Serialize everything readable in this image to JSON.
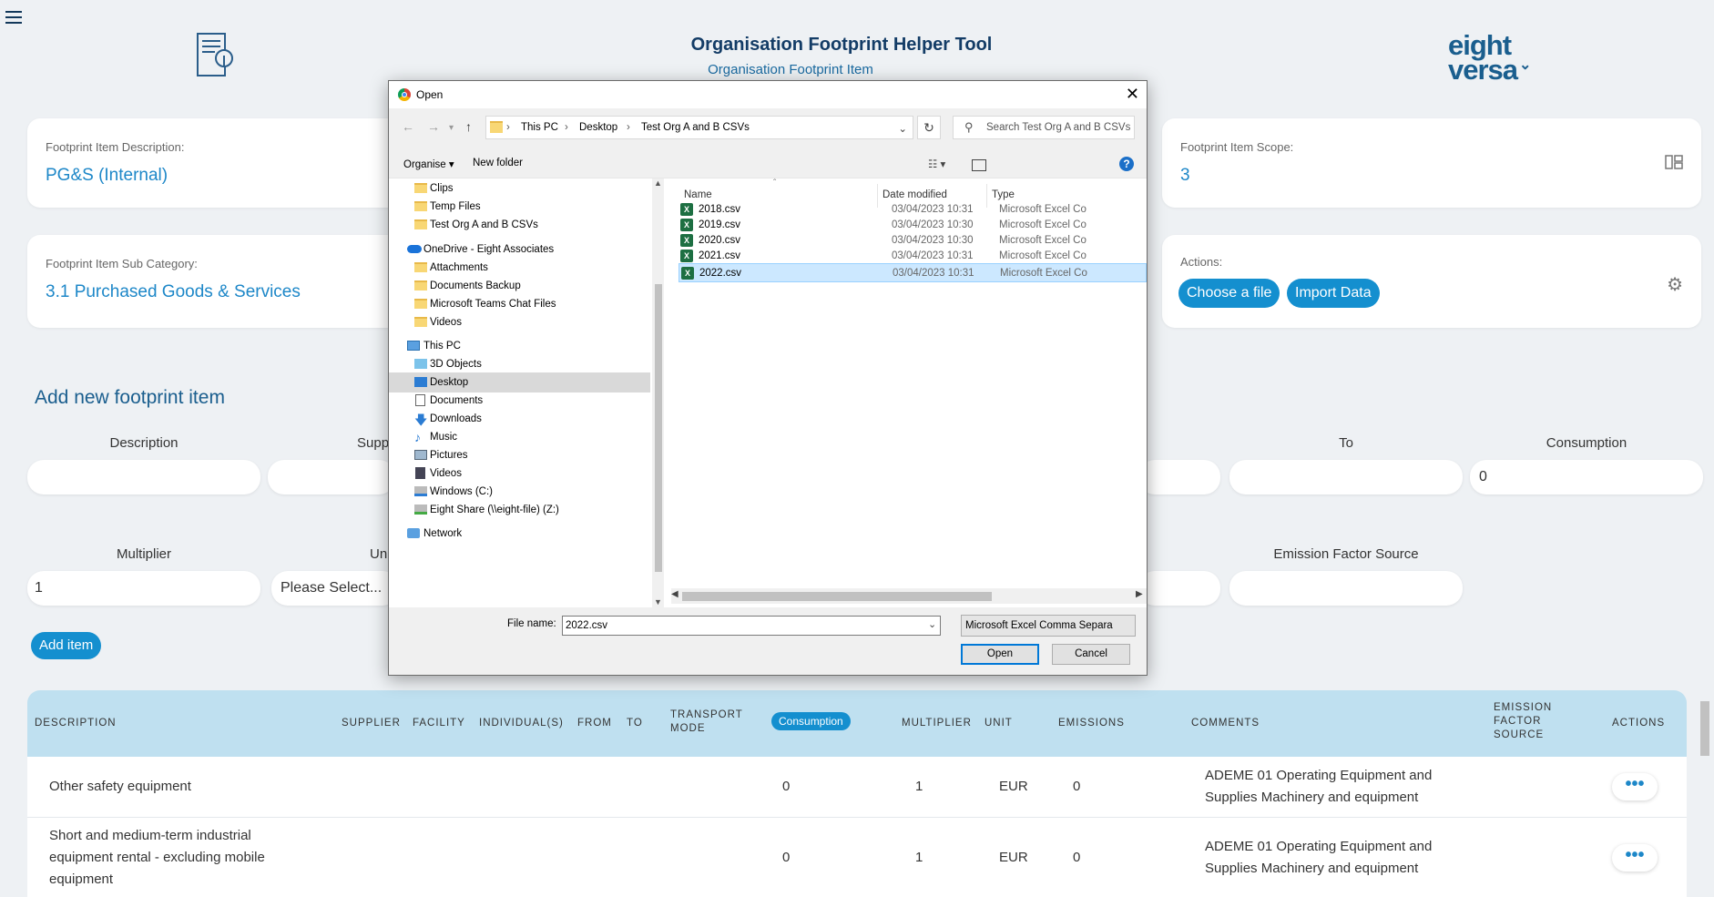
{
  "header": {
    "title": "Organisation Footprint Helper Tool",
    "subtitle": "Organisation Footprint Item",
    "logo_line1": "eight",
    "logo_line2": "versa"
  },
  "cards": {
    "description_label": "Footprint Item Description:",
    "description_value": "PG&S (Internal)",
    "subcategory_label": "Footprint Item Sub Category:",
    "subcategory_value": "3.1 Purchased Goods & Services",
    "scope_label": "Footprint Item Scope:",
    "scope_value": "3",
    "actions_label": "Actions:",
    "choose_file": "Choose a file",
    "import_data": "Import Data"
  },
  "form": {
    "heading": "Add new footprint item",
    "description_label": "Description",
    "supplier_label": "Supp",
    "to_label": "To",
    "consumption_label": "Consumption",
    "consumption_value": "0",
    "multiplier_label": "Multiplier",
    "multiplier_value": "1",
    "unit_label": "Un",
    "unit_value": "Please Select...",
    "ef_source_label": "Emission Factor Source",
    "add_item": "Add item"
  },
  "table": {
    "headers": {
      "description": "DESCRIPTION",
      "supplier": "SUPPLIER",
      "facility": "FACILITY",
      "individuals": "INDIVIDUAL(S)",
      "from": "FROM",
      "to": "TO",
      "transport_line1": "TRANSPORT",
      "transport_line2": "MODE",
      "consumption": "Consumption",
      "multiplier": "MULTIPLIER",
      "unit": "UNIT",
      "emissions": "EMISSIONS",
      "comments": "COMMENTS",
      "ef_line1": "EMISSION",
      "ef_line2": "FACTOR",
      "ef_line3": "SOURCE",
      "actions": "ACTIONS"
    },
    "rows": [
      {
        "description": "Other safety equipment",
        "consumption": "0",
        "multiplier": "1",
        "unit": "EUR",
        "emissions": "0",
        "comments_line1": "ADEME 01 Operating Equipment and",
        "comments_line2": "Supplies Machinery and equipment",
        "actions": "•••"
      },
      {
        "description_line1": "Short and medium-term industrial",
        "description_line2": "equipment rental - excluding mobile",
        "description_line3": "equipment",
        "consumption": "0",
        "multiplier": "1",
        "unit": "EUR",
        "emissions": "0",
        "comments_line1": "ADEME 01 Operating Equipment and",
        "comments_line2": "Supplies Machinery and equipment",
        "actions": "•••"
      }
    ]
  },
  "dialog": {
    "title": "Open",
    "breadcrumb": [
      "This PC",
      "Desktop",
      "Test Org A and B CSVs"
    ],
    "search_placeholder": "Search Test Org A and B CSVs",
    "toolbar": {
      "organise": "Organise ▾",
      "new_folder": "New folder",
      "help": "?"
    },
    "tree": [
      {
        "label": "Clips",
        "icon": "folder-icon"
      },
      {
        "label": "Temp Files",
        "icon": "folder-icon"
      },
      {
        "label": "Test Org A and B CSVs",
        "icon": "folder-icon"
      },
      {
        "label": "OneDrive - Eight Associates",
        "icon": "onedrive-icon"
      },
      {
        "label": "Attachments",
        "icon": "folder-icon"
      },
      {
        "label": "Documents Backup",
        "icon": "folder-icon"
      },
      {
        "label": "Microsoft Teams Chat Files",
        "icon": "folder-icon"
      },
      {
        "label": "Videos",
        "icon": "folder-icon"
      },
      {
        "label": "This PC",
        "icon": "pc-icon"
      },
      {
        "label": "3D Objects",
        "icon": "3d-objects-icon"
      },
      {
        "label": "Desktop",
        "icon": "desktop-icon"
      },
      {
        "label": "Documents",
        "icon": "documents-icon"
      },
      {
        "label": "Downloads",
        "icon": "downloads-icon"
      },
      {
        "label": "Music",
        "icon": "music-icon"
      },
      {
        "label": "Pictures",
        "icon": "pictures-icon"
      },
      {
        "label": "Videos",
        "icon": "videos-icon"
      },
      {
        "label": "Windows (C:)",
        "icon": "drive-icon"
      },
      {
        "label": "Eight Share (\\\\eight-file) (Z:)",
        "icon": "network-drive-icon"
      },
      {
        "label": "Network",
        "icon": "network-icon"
      }
    ],
    "columns": {
      "name": "Name",
      "date": "Date modified",
      "type": "Type"
    },
    "files": [
      {
        "name": "2018.csv",
        "date": "03/04/2023 10:31",
        "type": "Microsoft Excel Co"
      },
      {
        "name": "2019.csv",
        "date": "03/04/2023 10:30",
        "type": "Microsoft Excel Co"
      },
      {
        "name": "2020.csv",
        "date": "03/04/2023 10:30",
        "type": "Microsoft Excel Co"
      },
      {
        "name": "2021.csv",
        "date": "03/04/2023 10:31",
        "type": "Microsoft Excel Co"
      },
      {
        "name": "2022.csv",
        "date": "03/04/2023 10:31",
        "type": "Microsoft Excel Co"
      }
    ],
    "file_name_label": "File name:",
    "file_name_value": "2022.csv",
    "file_type": "Microsoft Excel Comma Separa",
    "open_label": "Open",
    "cancel_label": "Cancel"
  },
  "colors": {
    "accent": "#148fcf",
    "title": "#133c66",
    "table_header": "#bfe0f0"
  }
}
